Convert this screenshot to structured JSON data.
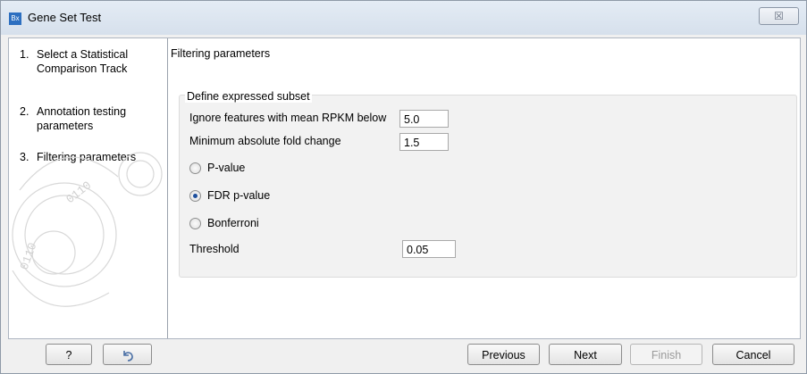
{
  "window": {
    "title": "Gene Set Test",
    "app_icon_text": "Bx",
    "close_label": "☒"
  },
  "steps": [
    {
      "number": "1.",
      "label": "Select a Statistical Comparison Track"
    },
    {
      "number": "2.",
      "label": "Annotation testing parameters"
    },
    {
      "number": "3.",
      "label": "Filtering parameters"
    }
  ],
  "panel": {
    "title": "Filtering parameters",
    "group_title": "Define expressed subset",
    "ignore_label": "Ignore features with mean RPKM below",
    "ignore_value": "5.0",
    "min_fold_label": "Minimum absolute fold change",
    "min_fold_value": "1.5",
    "radios": [
      {
        "label": "P-value",
        "checked": false
      },
      {
        "label": "FDR p-value",
        "checked": true
      },
      {
        "label": "Bonferroni",
        "checked": false
      }
    ],
    "threshold_label": "Threshold",
    "threshold_value": "0.05"
  },
  "footer": {
    "help_label": "?",
    "reset_icon": "reset-arrow-icon",
    "previous_label": "Previous",
    "next_label": "Next",
    "finish_label": "Finish",
    "cancel_label": "Cancel"
  },
  "colors": {
    "accent": "#2d6fc0",
    "radio_selected": "#1c4e9c"
  }
}
